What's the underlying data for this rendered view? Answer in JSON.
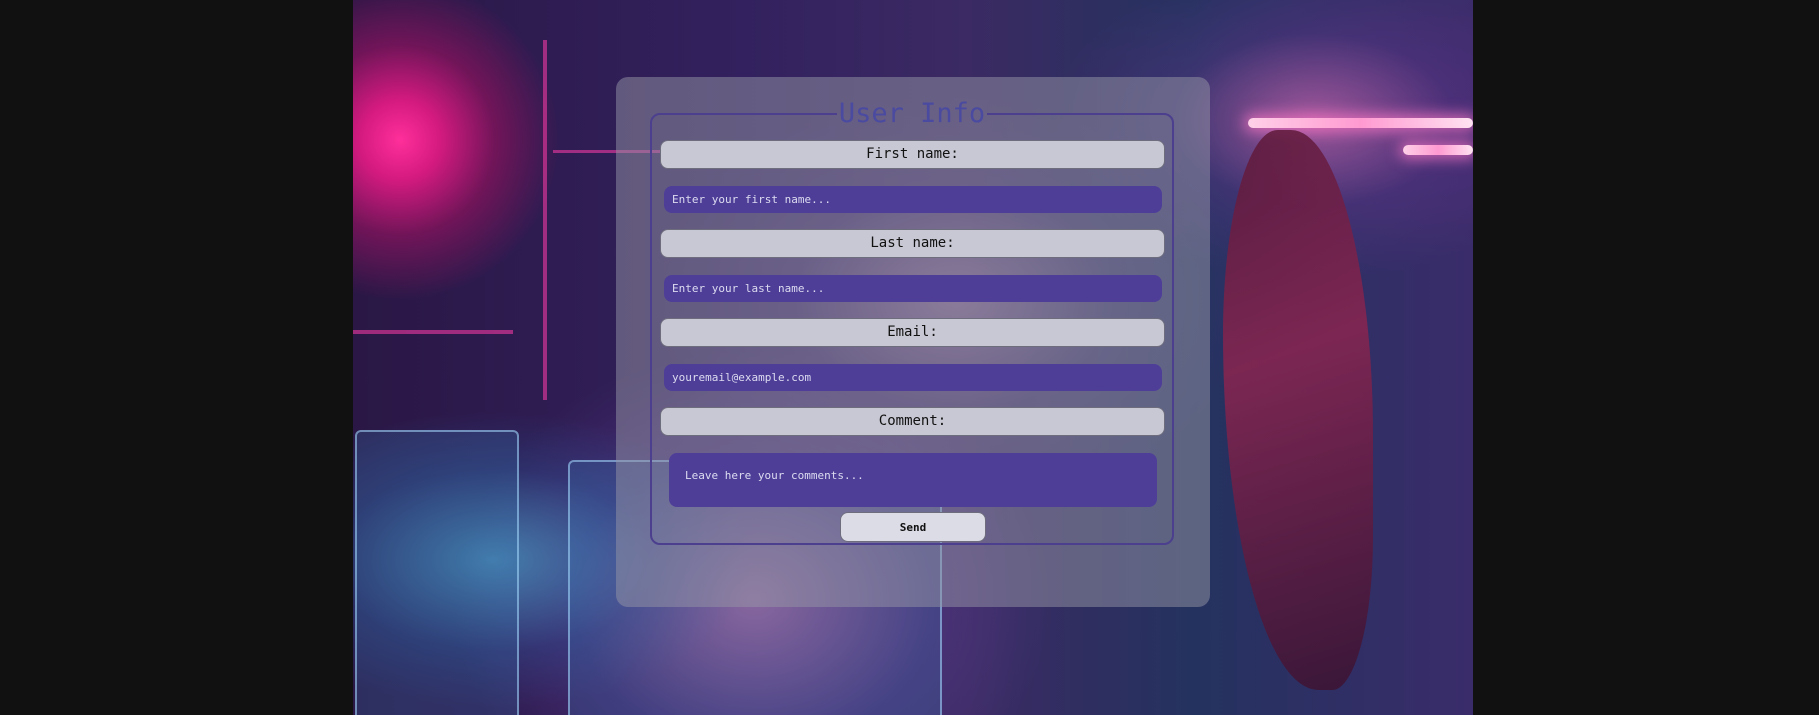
{
  "form": {
    "title": "User Info",
    "fields": [
      {
        "label": "First name:",
        "placeholder": "Enter your first name..."
      },
      {
        "label": "Last name:",
        "placeholder": "Enter your last name..."
      },
      {
        "label": "Email:",
        "placeholder": "youremail@example.com"
      }
    ],
    "comment": {
      "label": "Comment:",
      "placeholder": "Leave here your comments..."
    },
    "send_label": "Send"
  },
  "colors": {
    "page_background": "#111111",
    "input_fill": "#4e3e98",
    "label_fill": "#c8c8d4",
    "legend_text": "#4a4aa0",
    "fieldset_border": "#4b3f8e"
  }
}
